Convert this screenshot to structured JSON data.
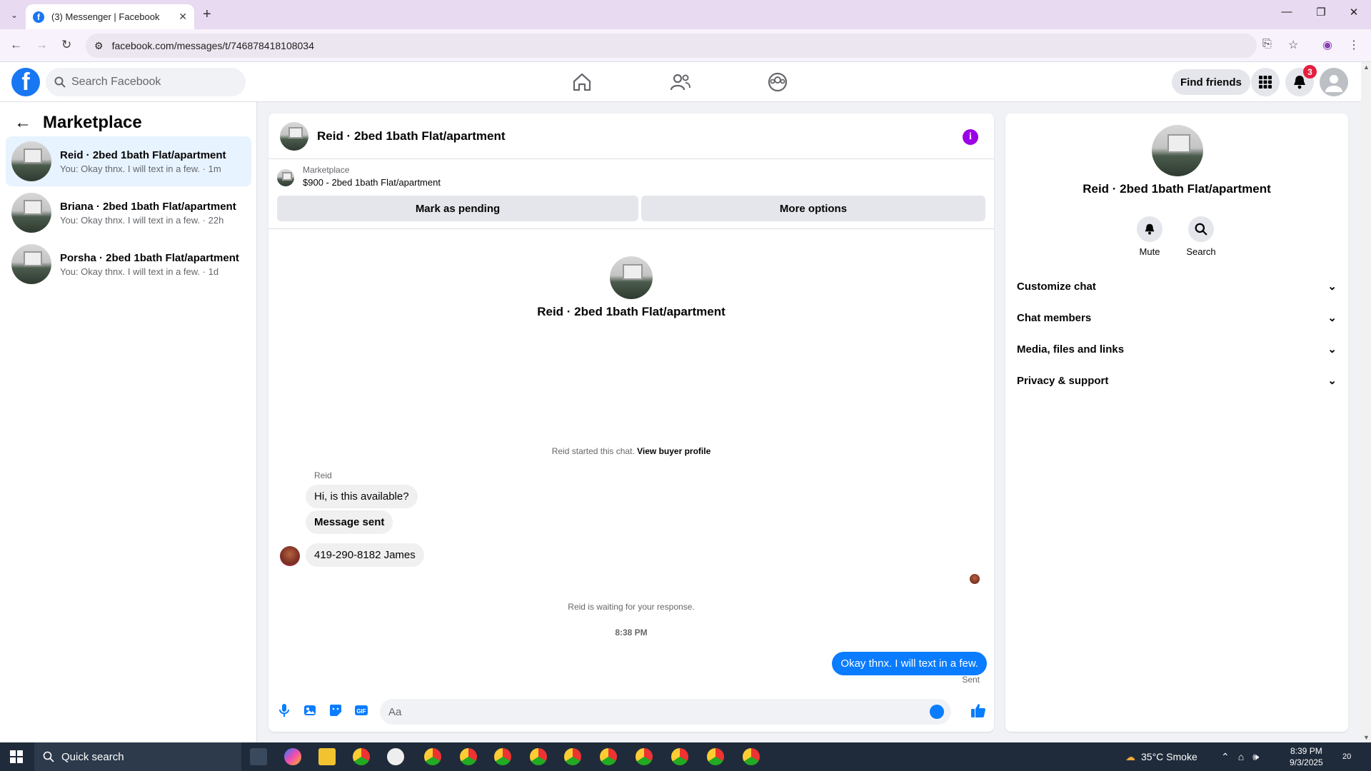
{
  "browser": {
    "tab_title": "(3) Messenger | Facebook",
    "url": "facebook.com/messages/t/746878418108034"
  },
  "fb": {
    "search_placeholder": "Search Facebook",
    "find_friends": "Find friends",
    "notification_count": "3",
    "brand_color": "#1877f2"
  },
  "left": {
    "title": "Marketplace",
    "conversations": [
      {
        "name": "Reid · 2bed 1bath Flat/apartment",
        "preview": "You: Okay thnx. I will text in a few. · 1m"
      },
      {
        "name": "Briana · 2bed 1bath Flat/apartment",
        "preview": "You: Okay thnx. I will text in a few. · 22h"
      },
      {
        "name": "Porsha · 2bed 1bath Flat/apartment",
        "preview": "You: Okay thnx. I will text in a few. · 1d"
      }
    ]
  },
  "chat": {
    "title": "Reid · 2bed 1bath Flat/apartment",
    "marketplace_label": "Marketplace",
    "listing": "$900 - 2bed 1bath Flat/apartment",
    "mark_pending": "Mark as pending",
    "more_options": "More options",
    "center_name": "Reid · 2bed 1bath Flat/apartment",
    "started_note": "Reid started this chat.",
    "view_buyer": "View buyer profile",
    "sender": "Reid",
    "msg1": "Hi, is this available?",
    "msg2": "Message sent",
    "msg3": "419-290-8182 James",
    "waiting": "Reid is waiting for your response.",
    "time": "8:38 PM",
    "my_msg": "Okay thnx. I will text in a few.",
    "sent": "Sent",
    "input_placeholder": "Aa",
    "accent": "#0a7cff"
  },
  "right": {
    "name": "Reid · 2bed 1bath Flat/apartment",
    "mute": "Mute",
    "search": "Search",
    "sections": [
      "Customize chat",
      "Chat members",
      "Media, files and links",
      "Privacy & support"
    ]
  },
  "taskbar": {
    "search": "Quick search",
    "weather": "35°C  Smoke",
    "time": "8:39 PM",
    "date": "9/3/2025",
    "notif": "20"
  }
}
